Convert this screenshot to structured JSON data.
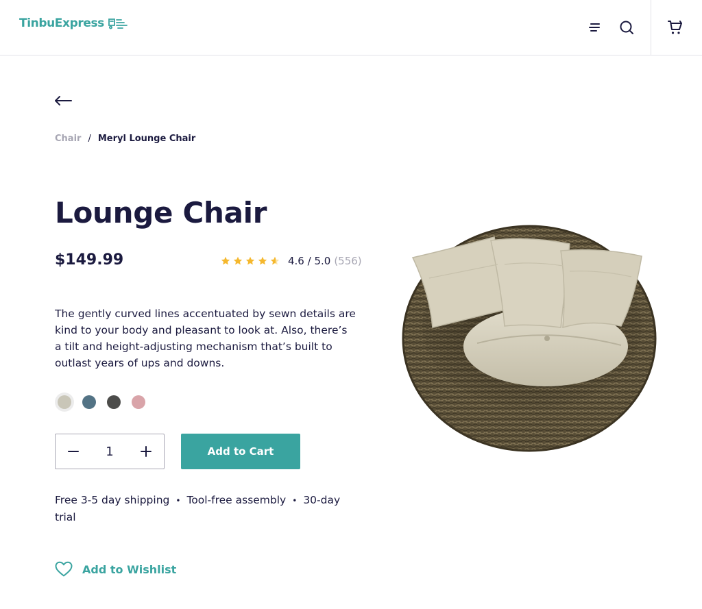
{
  "header": {
    "brand": "TinbuExpress",
    "brand_color": "#3aa4a0",
    "icons": [
      "truck-logo-icon",
      "menu-icon",
      "search-icon",
      "cart-icon"
    ]
  },
  "navigation": {
    "back_icon": "arrow-left-icon"
  },
  "breadcrumb": {
    "items": [
      {
        "label": "Chair"
      },
      {
        "label": "Meryl Lounge Chair"
      }
    ],
    "separator": "/"
  },
  "product": {
    "title": "Lounge Chair",
    "price": "$149.99",
    "rating": {
      "value": 4.6,
      "text": "4.6 / 5.0",
      "count": "(556)",
      "stars_filled": 4,
      "stars_partial": 0.6,
      "star_color": "#f5b82e"
    },
    "description": "The gently curved lines accentuated by sewn details are kind to your body and pleasant to look at. Also, there’s a tilt and height-adjusting mechanism that’s built to outlast years of ups and downs.",
    "colors": [
      {
        "name": "beige",
        "hex": "#c9c6b8",
        "selected": true
      },
      {
        "name": "slate-blue",
        "hex": "#537385",
        "selected": false
      },
      {
        "name": "charcoal",
        "hex": "#4c4c4a",
        "selected": false
      },
      {
        "name": "dusty-pink",
        "hex": "#d9a4a9",
        "selected": false
      }
    ],
    "quantity": "1",
    "add_to_cart_label": "Add to Cart",
    "perks": [
      "Free 3-5 day shipping",
      "Tool-free assembly",
      "30-day trial"
    ],
    "perk_separator": "•",
    "wishlist_label": "Add to Wishlist"
  },
  "colors": {
    "accent": "#3aa4a0",
    "text": "#1b1a3f",
    "muted": "#a7a6b3"
  }
}
